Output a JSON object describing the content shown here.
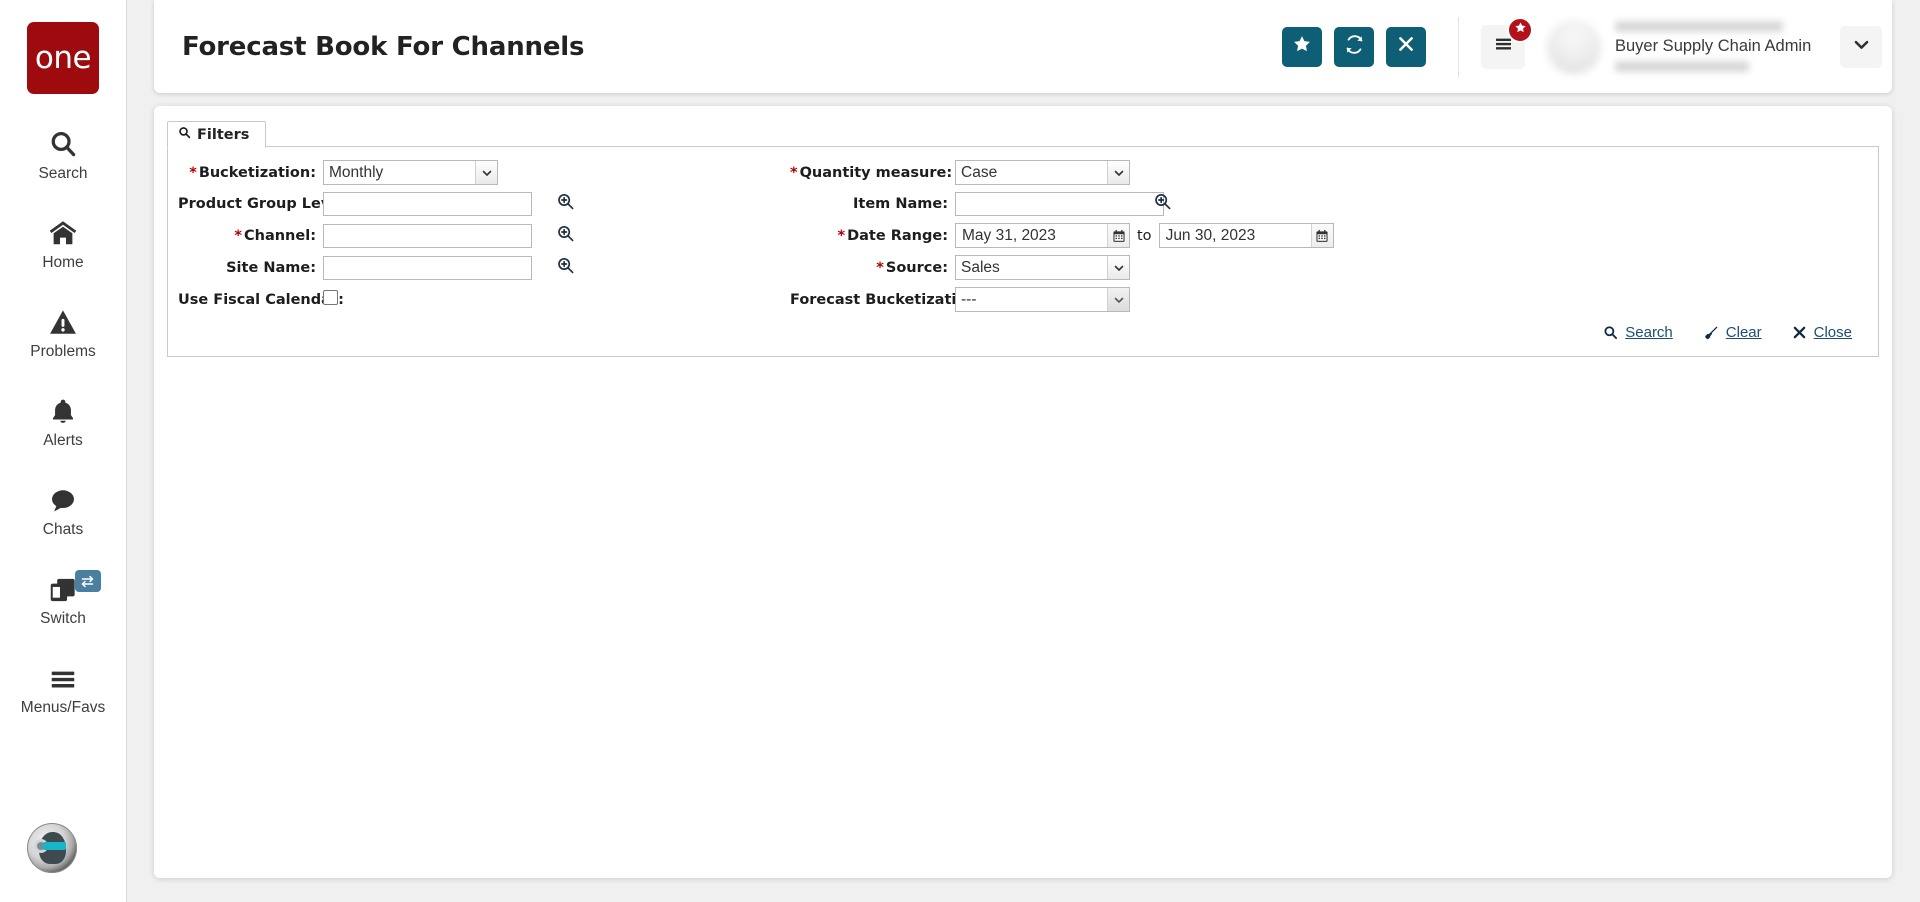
{
  "brand": {
    "logo_text": "one",
    "logo_color": "#9e0b0f"
  },
  "sidebar": {
    "items": [
      {
        "label": "Search",
        "icon": "search-icon"
      },
      {
        "label": "Home",
        "icon": "home-icon"
      },
      {
        "label": "Problems",
        "icon": "warning-triangle-icon"
      },
      {
        "label": "Alerts",
        "icon": "bell-icon"
      },
      {
        "label": "Chats",
        "icon": "chat-bubble-icon"
      },
      {
        "label": "Switch",
        "icon": "windows-stack-icon",
        "badge_icon": "swap-arrows-icon"
      },
      {
        "label": "Menus/Favs",
        "icon": "hamburger-icon"
      }
    ],
    "bot_avatar": "ai-assistant-avatar"
  },
  "header": {
    "title": "Forecast Book For Channels",
    "actions": [
      {
        "name": "favorite-button",
        "icon": "star-icon",
        "color": "#0e5f75"
      },
      {
        "name": "refresh-button",
        "icon": "refresh-icon",
        "color": "#0e5f75"
      },
      {
        "name": "close-button",
        "icon": "x-icon",
        "color": "#0e5f75"
      }
    ],
    "menu_button": {
      "icon": "hamburger-icon",
      "badge_icon": "star-icon",
      "badge_color": "#b3121b"
    },
    "user": {
      "role": "Buyer Supply Chain Admin",
      "name_masked": true
    },
    "dropdown_icon": "chevron-down-icon"
  },
  "filters": {
    "tab_label": "Filters",
    "tab_icon": "search-icon",
    "fields": {
      "bucketization": {
        "label": "Bucketization",
        "required": true,
        "type": "select",
        "value": "Monthly"
      },
      "product_group_level": {
        "label": "Product Group Level",
        "required": false,
        "type": "text",
        "value": ""
      },
      "channel": {
        "label": "Channel",
        "required": true,
        "type": "text",
        "value": ""
      },
      "site_name": {
        "label": "Site Name",
        "required": false,
        "type": "text",
        "value": ""
      },
      "use_fiscal_calendar": {
        "label": "Use Fiscal Calendar",
        "required": false,
        "type": "checkbox",
        "checked": false
      },
      "quantity_measure": {
        "label": "Quantity measure",
        "required": true,
        "type": "select",
        "value": "Case"
      },
      "item_name": {
        "label": "Item Name",
        "required": false,
        "type": "text",
        "value": ""
      },
      "date_range": {
        "label": "Date Range",
        "required": true,
        "type": "daterange",
        "from": "May 31, 2023",
        "to_word": "to",
        "to": "Jun 30, 2023"
      },
      "source": {
        "label": "Source",
        "required": true,
        "type": "select",
        "value": "Sales"
      },
      "forecast_bucketization": {
        "label": "Forecast Bucketization",
        "required": false,
        "type": "select",
        "value": "---"
      }
    },
    "actions": [
      {
        "label": "Search",
        "icon": "search-icon"
      },
      {
        "label": "Clear",
        "icon": "broom-icon"
      },
      {
        "label": "Close",
        "icon": "x-icon"
      }
    ]
  }
}
